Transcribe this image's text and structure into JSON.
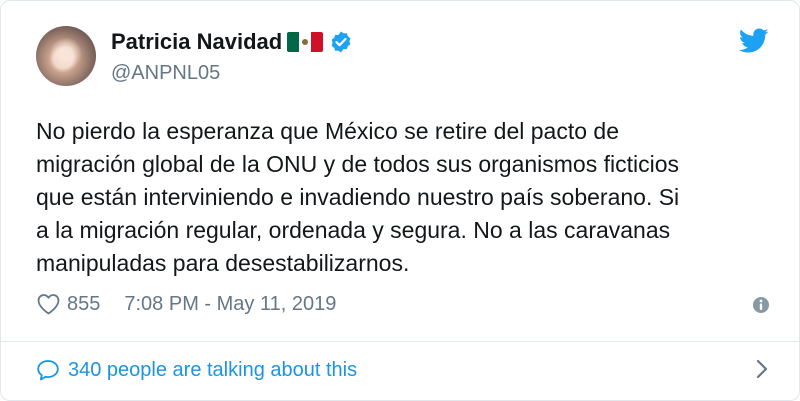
{
  "tweet": {
    "author_name": "Patricia Navidad",
    "handle": "@ANPNL05",
    "text": "No pierdo la esperanza que México se retire del pacto de\nmigración global de la ONU y de todos sus organismos ficticios\nque están interviniendo e invadiendo nuestro país soberano. Si\na la migración regular, ordenada y segura. No a las caravanas\nmanipuladas para desestabilizarnos.",
    "likes": "855",
    "timestamp": "7:08 PM - May 11, 2019",
    "talking": "340 people are talking about this"
  },
  "icons": {
    "verified": "verified-badge-icon",
    "flag": "mexico-flag-icon",
    "brand": "twitter-bird-icon",
    "like": "heart-icon",
    "info": "info-icon",
    "talk": "speech-bubble-icon",
    "next": "chevron-right-icon"
  },
  "colors": {
    "accent": "#1da1f2",
    "link": "#1b95e0",
    "muted": "#657786",
    "text": "#14171a",
    "border": "#e1e8ed"
  }
}
